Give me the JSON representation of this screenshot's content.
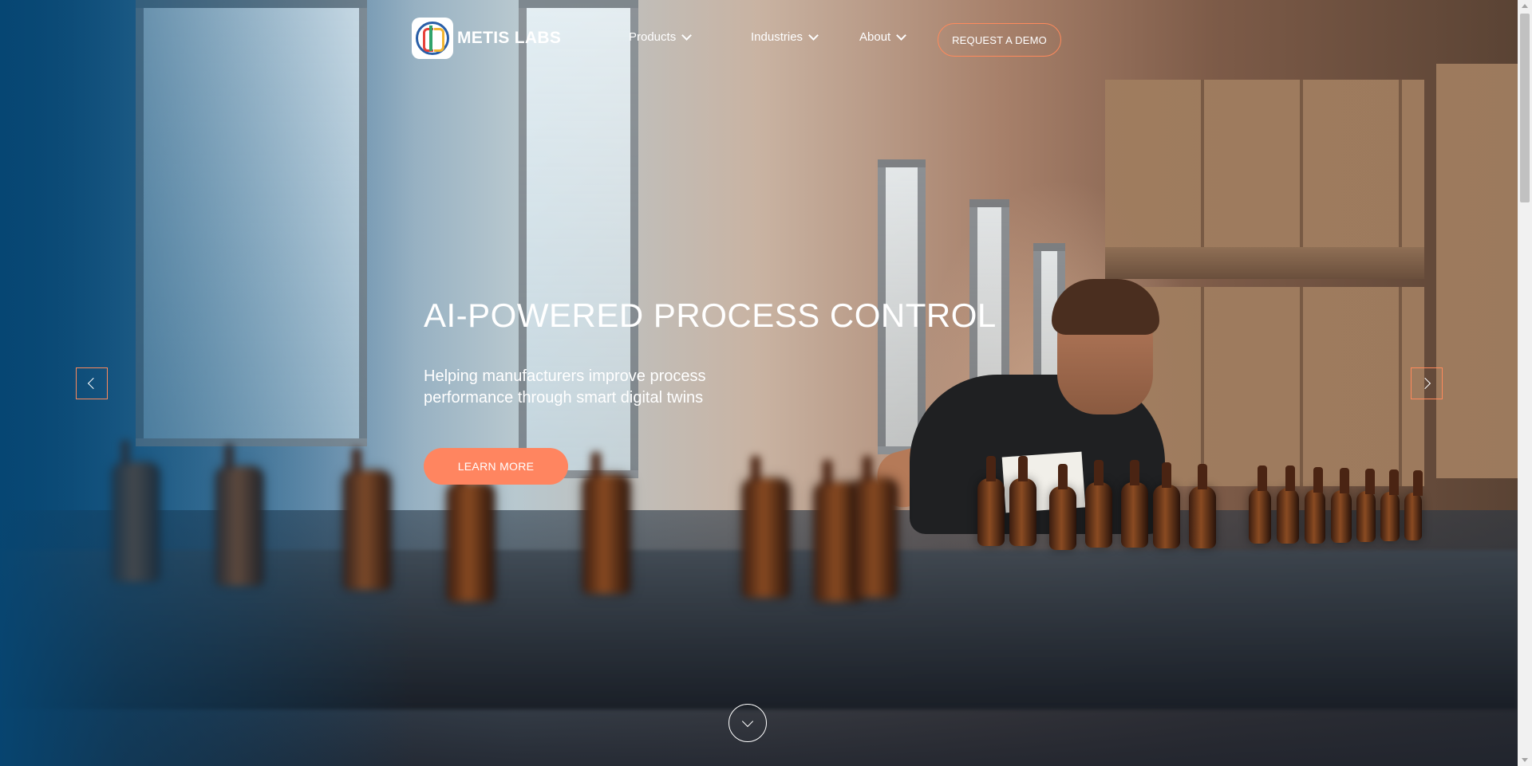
{
  "brand": {
    "name": "METIS LABS",
    "logo_icon": "brain-circuit-logo"
  },
  "nav": {
    "items": [
      {
        "label": "Products",
        "icon": "chevron-down-icon"
      },
      {
        "label": "Industries",
        "icon": "chevron-down-icon"
      },
      {
        "label": "About",
        "icon": "chevron-down-icon"
      }
    ],
    "cta_label": "REQUEST A DEMO"
  },
  "hero": {
    "title": "AI-POWERED PROCESS CONTROL",
    "subtitle": "Helping manufacturers improve process performance through smart digital twins",
    "button_label": "LEARN MORE",
    "prev_icon": "chevron-left-icon",
    "next_icon": "chevron-right-icon",
    "scroll_icon": "chevron-down-circle-icon"
  },
  "colors": {
    "accent": "#ff8560",
    "accent_border": "#ff8a5c",
    "overlay_blue": "#064673"
  }
}
